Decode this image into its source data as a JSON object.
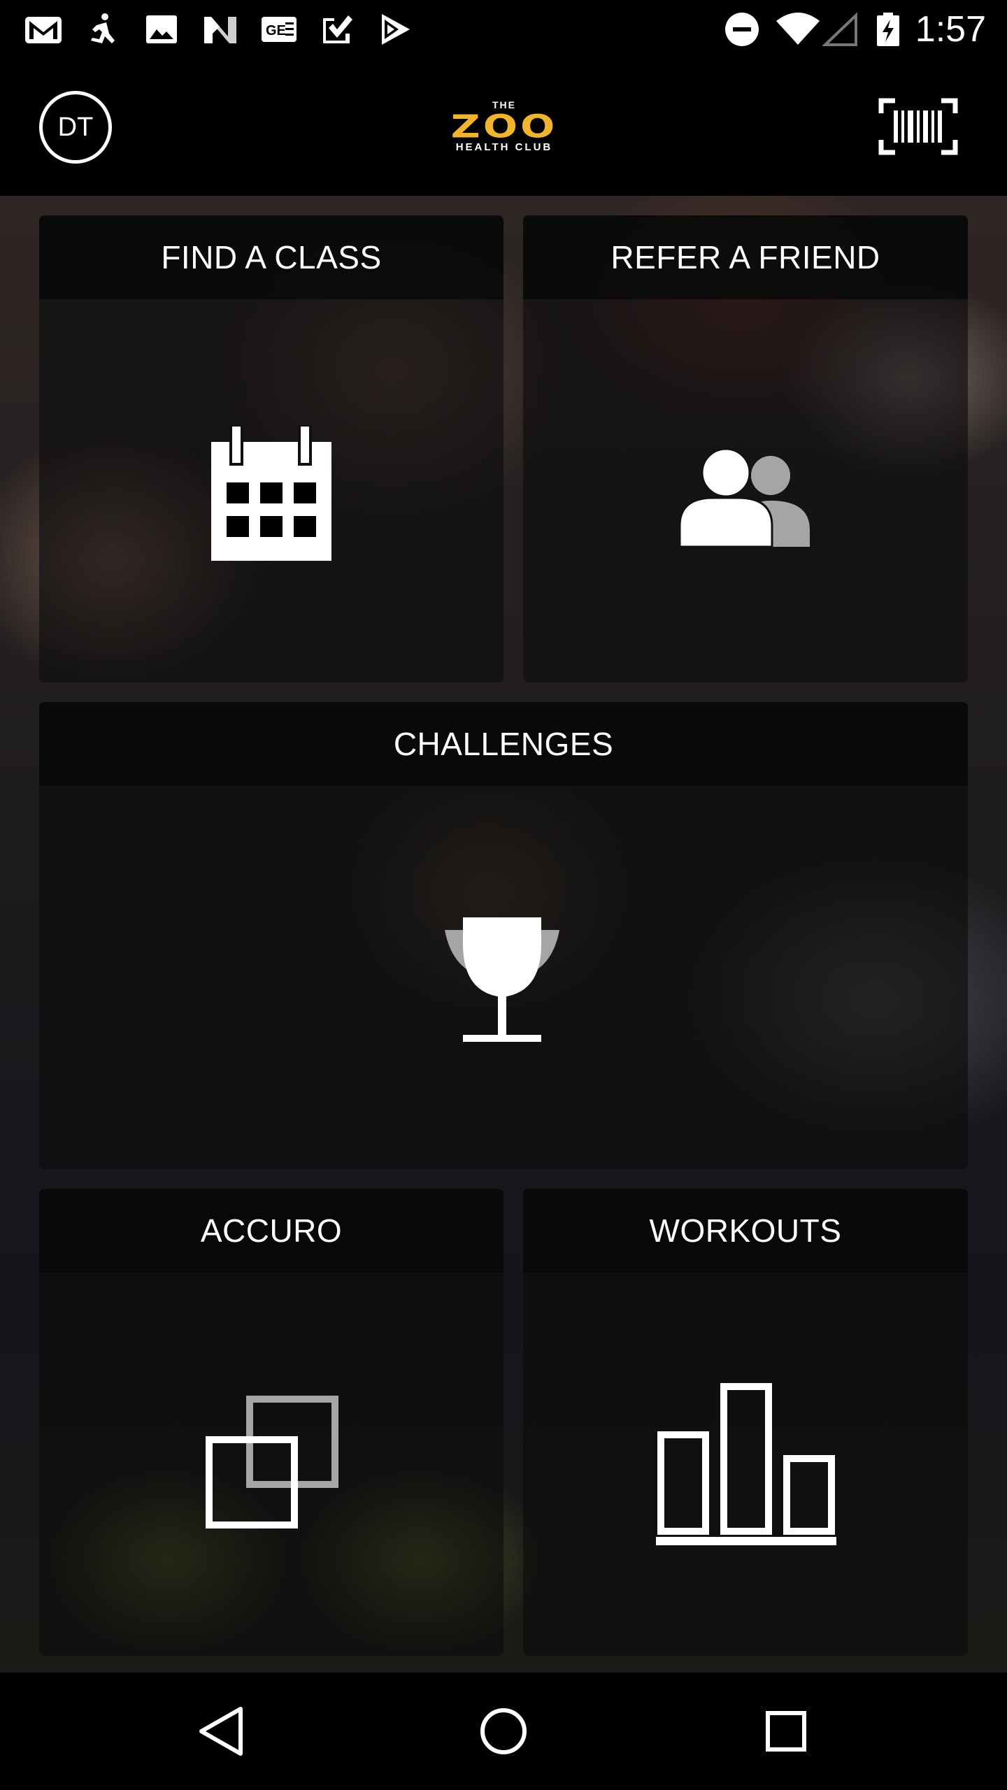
{
  "status_bar": {
    "time": "1:57",
    "left_icons": [
      "gmail-icon",
      "runner-icon",
      "image-icon",
      "n-icon",
      "ge-icon",
      "check-icon",
      "play-store-icon"
    ],
    "right_icons": [
      "do-not-disturb-icon",
      "wifi-icon",
      "signal-icon",
      "battery-charging-icon"
    ]
  },
  "app_bar": {
    "avatar_initials": "DT",
    "logo": {
      "the": "THE",
      "name": "ZOO",
      "sub": "HEALTH CLUB"
    },
    "action_icon": "barcode-icon"
  },
  "tiles": [
    {
      "id": "find-a-class",
      "label": "FIND A CLASS",
      "icon": "calendar-icon"
    },
    {
      "id": "refer-a-friend",
      "label": "REFER A FRIEND",
      "icon": "people-icon"
    },
    {
      "id": "challenges",
      "label": "CHALLENGES",
      "icon": "trophy-icon"
    },
    {
      "id": "accuro",
      "label": "ACCURO",
      "icon": "overlap-squares-icon"
    },
    {
      "id": "workouts",
      "label": "WORKOUTS",
      "icon": "bar-chart-icon"
    }
  ],
  "nav_bar": {
    "buttons": [
      "back-icon",
      "home-icon",
      "recents-icon"
    ]
  },
  "colors": {
    "logo_gold": "#f1b52d",
    "tile_header": "#0a0a0a",
    "icon_white": "#ffffff",
    "icon_gray": "#a5a5a5"
  }
}
